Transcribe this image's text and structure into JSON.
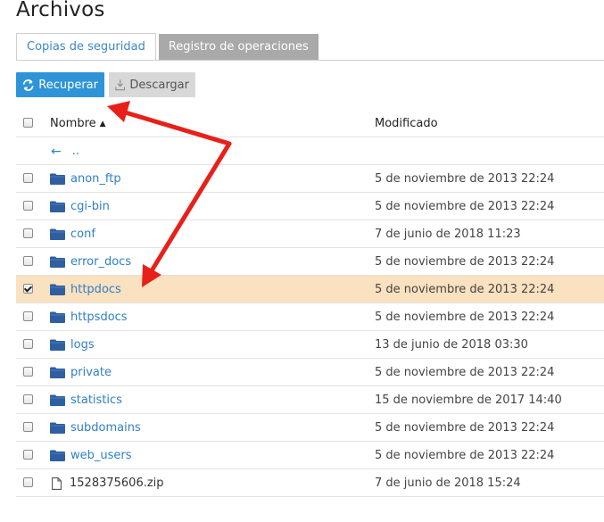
{
  "page": {
    "title": "Archivos"
  },
  "tabs": [
    {
      "label": "Copias de seguridad",
      "active": true
    },
    {
      "label": "Registro de operaciones",
      "active": false
    }
  ],
  "toolbar": {
    "recover_label": "Recuperar",
    "download_label": "Descargar"
  },
  "table": {
    "col_name": "Nombre",
    "col_modified": "Modificado",
    "parent_label": "..",
    "rows": [
      {
        "name": "anon_ftp",
        "modified": "5 de noviembre de 2013 22:24",
        "type": "folder",
        "checked": false
      },
      {
        "name": "cgi-bin",
        "modified": "5 de noviembre de 2013 22:24",
        "type": "folder",
        "checked": false
      },
      {
        "name": "conf",
        "modified": "7 de junio de 2018 11:23",
        "type": "folder",
        "checked": false
      },
      {
        "name": "error_docs",
        "modified": "5 de noviembre de 2013 22:24",
        "type": "folder",
        "checked": false
      },
      {
        "name": "httpdocs",
        "modified": "5 de noviembre de 2013 22:24",
        "type": "folder",
        "checked": true
      },
      {
        "name": "httpsdocs",
        "modified": "5 de noviembre de 2013 22:24",
        "type": "folder",
        "checked": false
      },
      {
        "name": "logs",
        "modified": "13 de junio de 2018 03:30",
        "type": "folder",
        "checked": false
      },
      {
        "name": "private",
        "modified": "5 de noviembre de 2013 22:24",
        "type": "folder",
        "checked": false
      },
      {
        "name": "statistics",
        "modified": "15 de noviembre de 2017 14:40",
        "type": "folder",
        "checked": false
      },
      {
        "name": "subdomains",
        "modified": "5 de noviembre de 2013 22:24",
        "type": "folder",
        "checked": false
      },
      {
        "name": "web_users",
        "modified": "5 de noviembre de 2013 22:24",
        "type": "folder",
        "checked": false
      },
      {
        "name": "1528375606.zip",
        "modified": "7 de junio de 2018 15:24",
        "type": "file",
        "checked": false
      }
    ]
  },
  "colors": {
    "accent": "#2f94d7",
    "link": "#2f7fc8",
    "selected_row": "#fae1c0",
    "annotation_arrow": "#e8201a"
  }
}
